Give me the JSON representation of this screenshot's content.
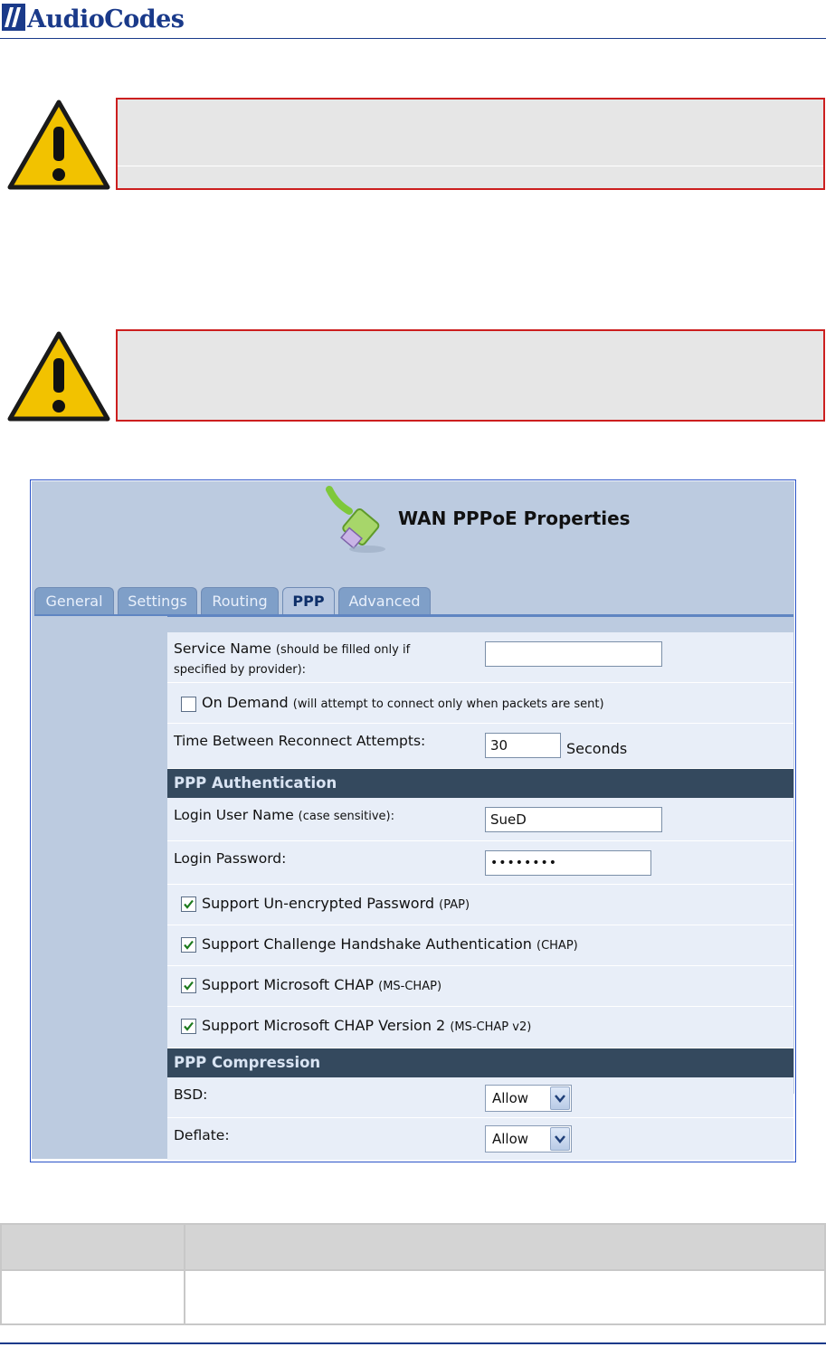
{
  "header": {
    "logo_text": "AudioCodes"
  },
  "warnings": [
    {
      "icon": "warning-icon"
    },
    {
      "icon": "warning-icon"
    }
  ],
  "panel": {
    "title": "WAN PPPoE Properties",
    "tabs": [
      "General",
      "Settings",
      "Routing",
      "PPP",
      "Advanced"
    ],
    "active_tab": "PPP",
    "service_name": {
      "label": "Service Name",
      "hint1": "(should be filled only if",
      "hint2": "specified by provider):",
      "value": ""
    },
    "on_demand": {
      "label": "On Demand",
      "hint": "(will attempt to connect only when packets are sent)",
      "checked": false
    },
    "reconnect": {
      "label": "Time Between Reconnect Attempts:",
      "value": "30",
      "unit": "Seconds"
    },
    "auth_section": "PPP Authentication",
    "login_user": {
      "label": "Login User Name",
      "hint": "(case sensitive):",
      "value": "SueD"
    },
    "login_password": {
      "label": "Login Password:",
      "value": "••••••••"
    },
    "checks": [
      {
        "label": "Support Un-encrypted Password",
        "hint": "(PAP)",
        "checked": true
      },
      {
        "label": "Support Challenge Handshake Authentication",
        "hint": "(CHAP)",
        "checked": true
      },
      {
        "label": "Support Microsoft CHAP",
        "hint": "(MS-CHAP)",
        "checked": true
      },
      {
        "label": "Support Microsoft CHAP Version 2",
        "hint": "(MS-CHAP v2)",
        "checked": true
      }
    ],
    "compression_section": "PPP Compression",
    "bsd": {
      "label": "BSD:",
      "value": "Allow"
    },
    "deflate": {
      "label": "Deflate:",
      "value": "Allow"
    }
  },
  "colors": {
    "brand": "#1a3a8a",
    "warning_border": "#cc1f1f",
    "section_bg": "#34495e"
  }
}
